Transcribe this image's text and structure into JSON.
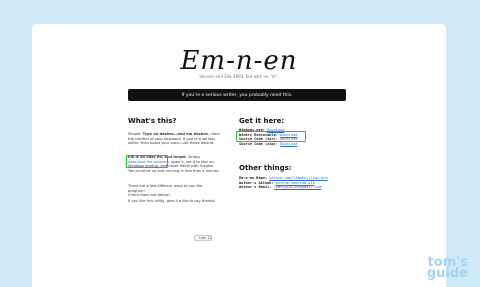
{
  "hero": {
    "title": "Em-n-en",
    "tagline": "Version and Site 4893, but with no “in”."
  },
  "banner": {
    "text": "If you're a serious writer, you probably need this."
  },
  "left": {
    "title": "What's this?",
    "para1_start": "Simple: ",
    "para1_bold": "Type en dashes—and em dashes",
    "para1_rest1": "—from",
    "para1_rest2": "the comfort of your keyboard. If you're a serious",
    "para1_rest3": "writer, then boost your prod—use these dashes",
    "para2_start": "Em is an easy fix, and forget",
    "para2_rest": ". Simply",
    "para2_link": "download the program",
    "para2_after": ", open it, set it to Mac on",
    "para2_line3": "Windows startup, and never fiddle with it again.",
    "para2_line4": "You could be up and running in less than a minute.",
    "para3_line1": "There are a few different ways to you the program!",
    "para3_line2": "Check them out below!",
    "para4": "If you like this utility, give it a like to say thanks!",
    "like_label": "Like",
    "like_count": "11"
  },
  "right": {
    "title": "Get it here:",
    "rows": [
      {
        "label": "Windows.exe:",
        "value": "Download"
      },
      {
        "label": "Winery Executable:",
        "value": "Download"
      },
      {
        "label": "Source Code (tar):",
        "value": "Download"
      },
      {
        "label": "Source Code (zip):",
        "value": "Download"
      }
    ],
    "other_title": "Other things:",
    "other_rows": [
      {
        "label": "Em-n-en Repo:",
        "value": "github.com/liamkcillian-enk"
      },
      {
        "label": "Author's Github:",
        "value": "github.com/lom-o1k"
      },
      {
        "label": "Author's Email:",
        "value": "lomnyg+en+en@gmail.com"
      }
    ]
  },
  "watermark": {
    "line1": "tom's",
    "line2": "guide"
  },
  "colors": {
    "highlight_box": "#22c42e",
    "link": "#2b74c8",
    "background": "#cfe9f7",
    "banner_bg": "#111111"
  }
}
